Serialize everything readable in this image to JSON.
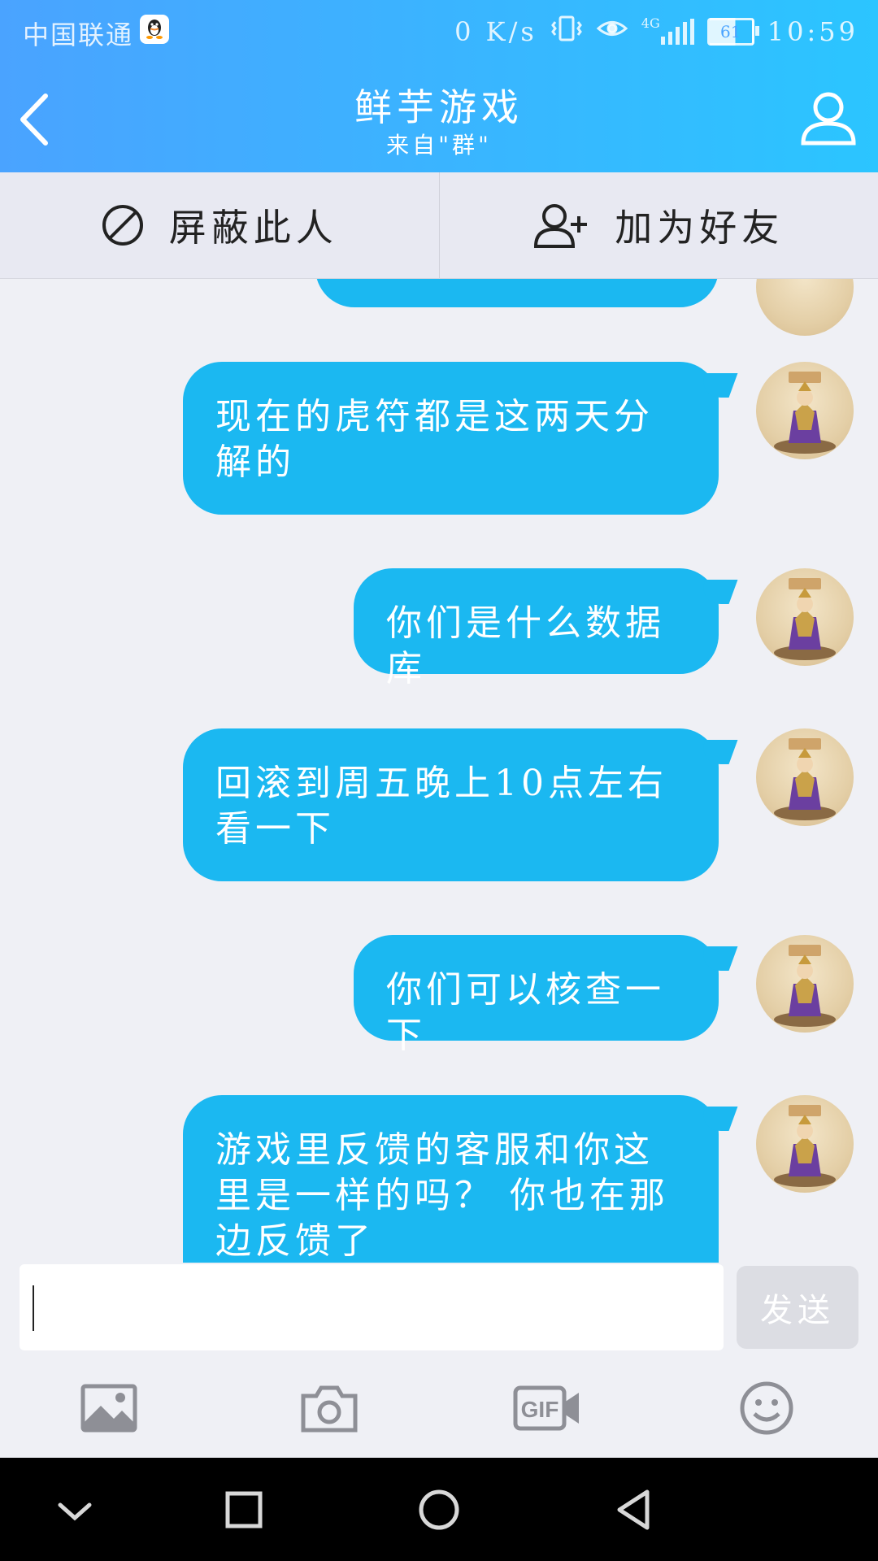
{
  "status_bar": {
    "carrier": "中国联通",
    "network_speed": "0 K/s",
    "network_type": "4G",
    "battery": "61",
    "time": "10:59"
  },
  "header": {
    "title": "鲜芋游戏",
    "subtitle": "来自\"群\"",
    "gradient_start": "#4aa3ff",
    "gradient_end": "#2bc5ff"
  },
  "action_bar": {
    "block_label": "屏蔽此人",
    "add_friend_label": "加为好友"
  },
  "messages": [
    {
      "text": ""
    },
    {
      "text": "现在的虎符都是这两天分解的"
    },
    {
      "text": "你们是什么数据库"
    },
    {
      "text": "回滚到周五晚上10点左右看一下"
    },
    {
      "text": "你们可以核查一下"
    },
    {
      "text": "游戏里反馈的客服和你这里是一样的吗？ 你也在那边反馈了"
    }
  ],
  "bubble_color": "#1bb8f1",
  "input": {
    "value": "",
    "send_label": "发送"
  },
  "toolbar": {
    "image_icon": "image-icon",
    "camera_icon": "camera-icon",
    "gif_icon": "gif-icon",
    "emoji_icon": "emoji-icon",
    "gif_label": "GIF"
  }
}
